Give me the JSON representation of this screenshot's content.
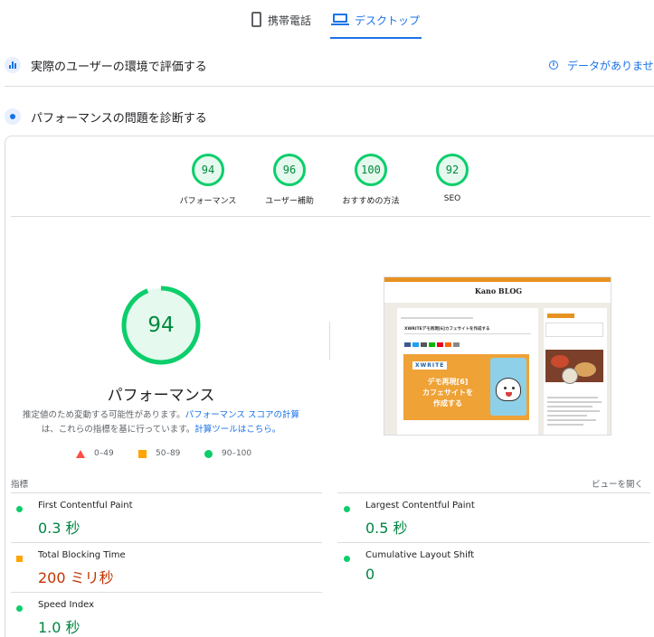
{
  "device_tabs": {
    "mobile": "携帯電話",
    "desktop": "デスクトップ",
    "active": "desktop"
  },
  "field_section": {
    "title": "実際のユーザーの環境で評価する",
    "no_data": "データがありません"
  },
  "lab_section": {
    "title": "パフォーマンスの問題を診断する"
  },
  "scores": [
    {
      "value": "94",
      "label": "パフォーマンス"
    },
    {
      "value": "96",
      "label": "ユーザー補助"
    },
    {
      "value": "100",
      "label": "おすすめの方法"
    },
    {
      "value": "92",
      "label": "SEO"
    }
  ],
  "performance": {
    "score": "94",
    "score_fraction": 0.94,
    "title": "パフォーマンス",
    "desc_1": "推定値のため変動する可能性があります。",
    "desc_link_1": "パフォーマンス スコアの計算",
    "desc_2": "は、これらの指標を基に行っています。",
    "desc_link_2": "計算ツールはこちら。"
  },
  "legend": {
    "fail": "0–49",
    "average": "50–89",
    "pass": "90–100"
  },
  "thumbnail": {
    "brand": "Kano BLOG",
    "post_title": "XWRITEデモ再現[6]カフェサイトを作成する",
    "hero_badge": "XWRITE",
    "hero_line1": "デモ再現[6]",
    "hero_line2": "カフェサイトを",
    "hero_line3": "作成する"
  },
  "metrics_header": {
    "label": "指標",
    "expand": "ビューを開く"
  },
  "metrics": {
    "fcp": {
      "name": "First Contentful Paint",
      "value": "0.3 秒",
      "rating": "good"
    },
    "lcp": {
      "name": "Largest Contentful Paint",
      "value": "0.5 秒",
      "rating": "good"
    },
    "tbt": {
      "name": "Total Blocking Time",
      "value": "200 ミリ秒",
      "rating": "average"
    },
    "cls": {
      "name": "Cumulative Layout Shift",
      "value": "0",
      "rating": "good"
    },
    "si": {
      "name": "Speed Index",
      "value": "1.0 秒",
      "rating": "good"
    }
  },
  "colors": {
    "accent": "#1a73e8",
    "pass": "#0cce6b",
    "average": "#ffa400",
    "fail": "#ff4e42"
  }
}
